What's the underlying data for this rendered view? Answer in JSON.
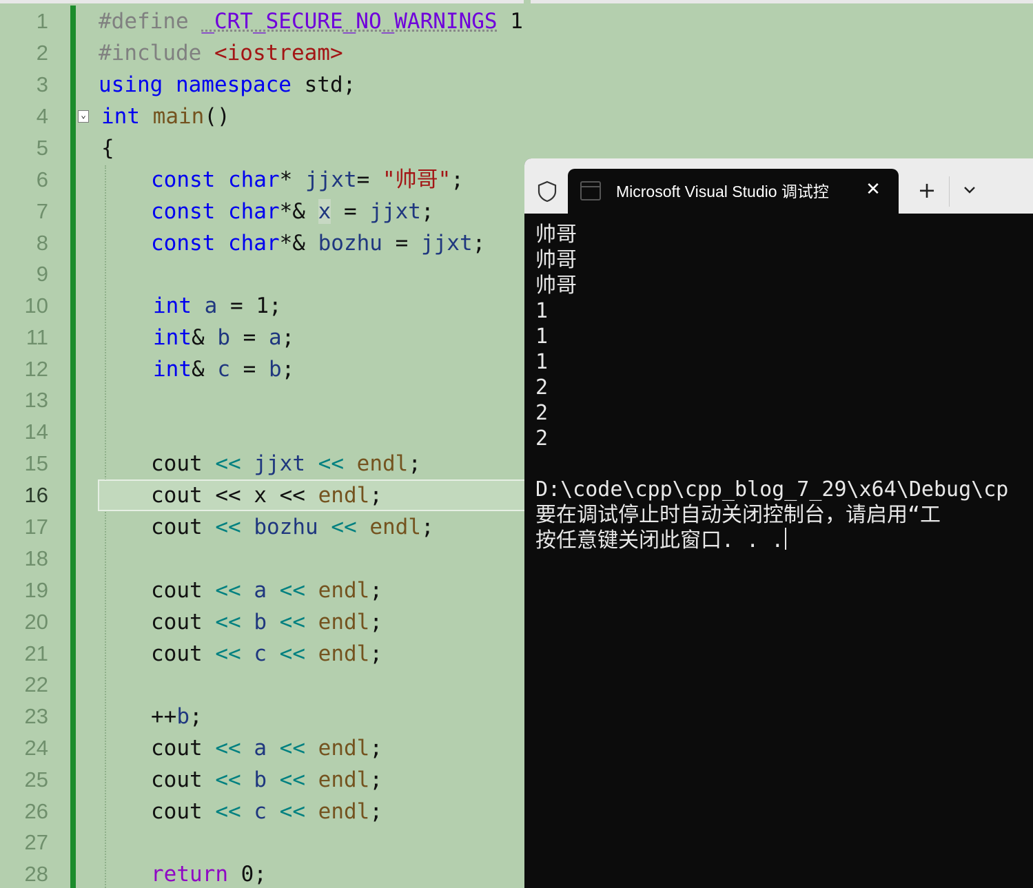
{
  "editor": {
    "current_line": "16",
    "line_numbers": [
      "1",
      "2",
      "3",
      "4",
      "5",
      "6",
      "7",
      "8",
      "9",
      "10",
      "11",
      "12",
      "13",
      "14",
      "15",
      "16",
      "17",
      "18",
      "19",
      "20",
      "21",
      "22",
      "23",
      "24",
      "25",
      "26",
      "27",
      "28"
    ],
    "code": {
      "l1": {
        "a": "#define ",
        "b": "_CRT_SECURE_NO_WARNINGS",
        "c": " 1"
      },
      "l2": {
        "a": "#include ",
        "b": "<iostream>"
      },
      "l3": {
        "a": "using namespace",
        "b": " std;"
      },
      "l4": {
        "a": "int",
        "b": " ",
        "c": "main",
        "d": "()"
      },
      "l5": {
        "a": "{"
      },
      "l6": {
        "a": "const char",
        "b": "* ",
        "c": "jjxt",
        "d": "= ",
        "e": "\"帅哥\"",
        "f": ";"
      },
      "l7": {
        "a": "const char",
        "b": "*& ",
        "c": "x",
        "d": " = ",
        "e": "jjxt",
        "f": ";"
      },
      "l8": {
        "a": "const char",
        "b": "*& ",
        "c": "bozhu",
        "d": " = ",
        "e": "jjxt",
        "f": ";"
      },
      "l10": {
        "a": "int",
        "b": " ",
        "c": "a",
        "d": " = 1;"
      },
      "l11": {
        "a": "int",
        "b": "& ",
        "c": "b",
        "d": " = ",
        "e": "a",
        "f": ";"
      },
      "l12": {
        "a": "int",
        "b": "& ",
        "c": "c",
        "d": " = ",
        "e": "b",
        "f": ";"
      },
      "l15": {
        "a": "cout ",
        "b": "<<",
        "c": " ",
        "d": "jjxt",
        "e": " ",
        "f": "<<",
        "g": " ",
        "h": "endl",
        "i": ";"
      },
      "l16": {
        "a": "cout << ",
        "b": "x",
        "c": " << ",
        "d": "endl",
        "e": ";"
      },
      "l17": {
        "a": "cout ",
        "b": "<<",
        "c": " ",
        "d": "bozhu",
        "e": " ",
        "f": "<<",
        "g": " ",
        "h": "endl",
        "i": ";"
      },
      "l19": {
        "a": "cout ",
        "b": "<<",
        "c": " ",
        "d": "a",
        "e": " ",
        "f": "<<",
        "g": " ",
        "h": "endl",
        "i": ";"
      },
      "l20": {
        "a": "cout ",
        "b": "<<",
        "c": " ",
        "d": "b",
        "e": " ",
        "f": "<<",
        "g": " ",
        "h": "endl",
        "i": ";"
      },
      "l21": {
        "a": "cout ",
        "b": "<<",
        "c": " ",
        "d": "c",
        "e": " ",
        "f": "<<",
        "g": " ",
        "h": "endl",
        "i": ";"
      },
      "l23": {
        "a": "++",
        "b": "b",
        "c": ";"
      },
      "l24": {
        "a": "cout ",
        "b": "<<",
        "c": " ",
        "d": "a",
        "e": " ",
        "f": "<<",
        "g": " ",
        "h": "endl",
        "i": ";"
      },
      "l25": {
        "a": "cout ",
        "b": "<<",
        "c": " ",
        "d": "b",
        "e": " ",
        "f": "<<",
        "g": " ",
        "h": "endl",
        "i": ";"
      },
      "l26": {
        "a": "cout ",
        "b": "<<",
        "c": " ",
        "d": "c",
        "e": " ",
        "f": "<<",
        "g": " ",
        "h": "endl",
        "i": ";"
      },
      "l28": {
        "a": "return",
        "b": " 0;"
      }
    },
    "fold_glyph": "⌄"
  },
  "terminal": {
    "tab_title": "Microsoft Visual Studio 调试控",
    "close_glyph": "✕",
    "new_tab_glyph": "+",
    "output": [
      "帅哥",
      "帅哥",
      "帅哥",
      "1",
      "1",
      "1",
      "2",
      "2",
      "2",
      "",
      "D:\\code\\cpp\\cpp_blog_7_29\\x64\\Debug\\cp",
      "要在调试停止时自动关闭控制台，请启用“工",
      "按任意键关闭此窗口. . ."
    ]
  },
  "colors": {
    "editor_bg": "#b4cfae",
    "change_bar": "#1c8c2c",
    "terminal_bg": "#0c0c0c",
    "tab_bar_bg": "#ececec"
  },
  "icons": {
    "shield": "shield-icon",
    "terminal": "terminal-icon",
    "close": "close-icon",
    "plus": "plus-icon",
    "dropdown": "chevron-down-icon",
    "fold": "fold-collapse-icon"
  }
}
